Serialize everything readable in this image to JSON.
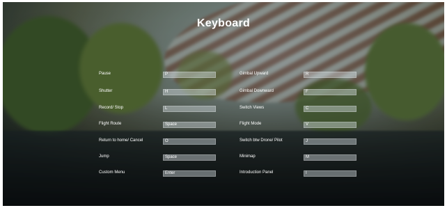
{
  "title": "Keyboard",
  "left_column": [
    {
      "label": "Pause",
      "key": "P"
    },
    {
      "label": "Shutter",
      "key": "H"
    },
    {
      "label": "Record/ Stop",
      "key": "L"
    },
    {
      "label": "Flight Route",
      "key": "Space"
    },
    {
      "label": "Return to home/ Cancel",
      "key": "O"
    },
    {
      "label": "Jump",
      "key": "Space"
    },
    {
      "label": "Custom Menu",
      "key": "Enter"
    }
  ],
  "right_column": [
    {
      "label": "Gimbal Upward",
      "key": "R"
    },
    {
      "label": "Gimbal Downward",
      "key": "F"
    },
    {
      "label": "Switch Views",
      "key": "C"
    },
    {
      "label": "Flight Mode",
      "key": "V"
    },
    {
      "label": "Switch btw Drone/ Pilot",
      "key": "J"
    },
    {
      "label": "Minimap",
      "key": "M"
    },
    {
      "label": "Introduction Panel",
      "key": "I"
    }
  ]
}
